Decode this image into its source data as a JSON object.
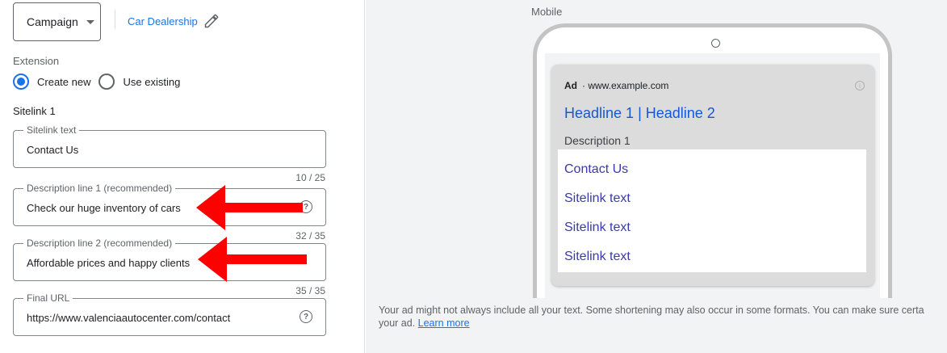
{
  "header": {
    "campaign_label": "Campaign",
    "dealer_label": "Car Dealership"
  },
  "extension": {
    "label": "Extension",
    "options": [
      "Create new",
      "Use existing"
    ],
    "selected": "Create new"
  },
  "sitelink": {
    "label": "Sitelink 1",
    "fields": {
      "text": {
        "legend": "Sitelink text",
        "value": "Contact Us",
        "counter": "10 / 25"
      },
      "desc1": {
        "legend": "Description line 1 (recommended)",
        "value": "Check our huge inventory of cars",
        "counter": "32 / 35"
      },
      "desc2": {
        "legend": "Description line 2 (recommended)",
        "value": "Affordable prices and happy clients",
        "counter": "35 / 35"
      },
      "url": {
        "legend": "Final URL",
        "value": "https://www.valenciaautocenter.com/contact"
      }
    }
  },
  "preview": {
    "device_label": "Mobile",
    "ad_badge": "Ad",
    "ad_url": "· www.example.com",
    "headline": "Headline 1 | Headline 2",
    "description": "Description 1",
    "sitelinks": [
      "Contact Us",
      "Sitelink text",
      "Sitelink text",
      "Sitelink text"
    ],
    "footnote": "Your ad might not always include all your text. Some shortening may also occur in some formats. You can make sure certa",
    "footnote_line2": "your ad.",
    "learn_more": "Learn more"
  },
  "icons": {
    "pencil": "pencil-icon",
    "help": "help-icon",
    "info": "info-icon",
    "arrow": "red-arrow-annotation"
  },
  "colors": {
    "accent": "#1a73e8",
    "arrow": "#ff0000"
  }
}
